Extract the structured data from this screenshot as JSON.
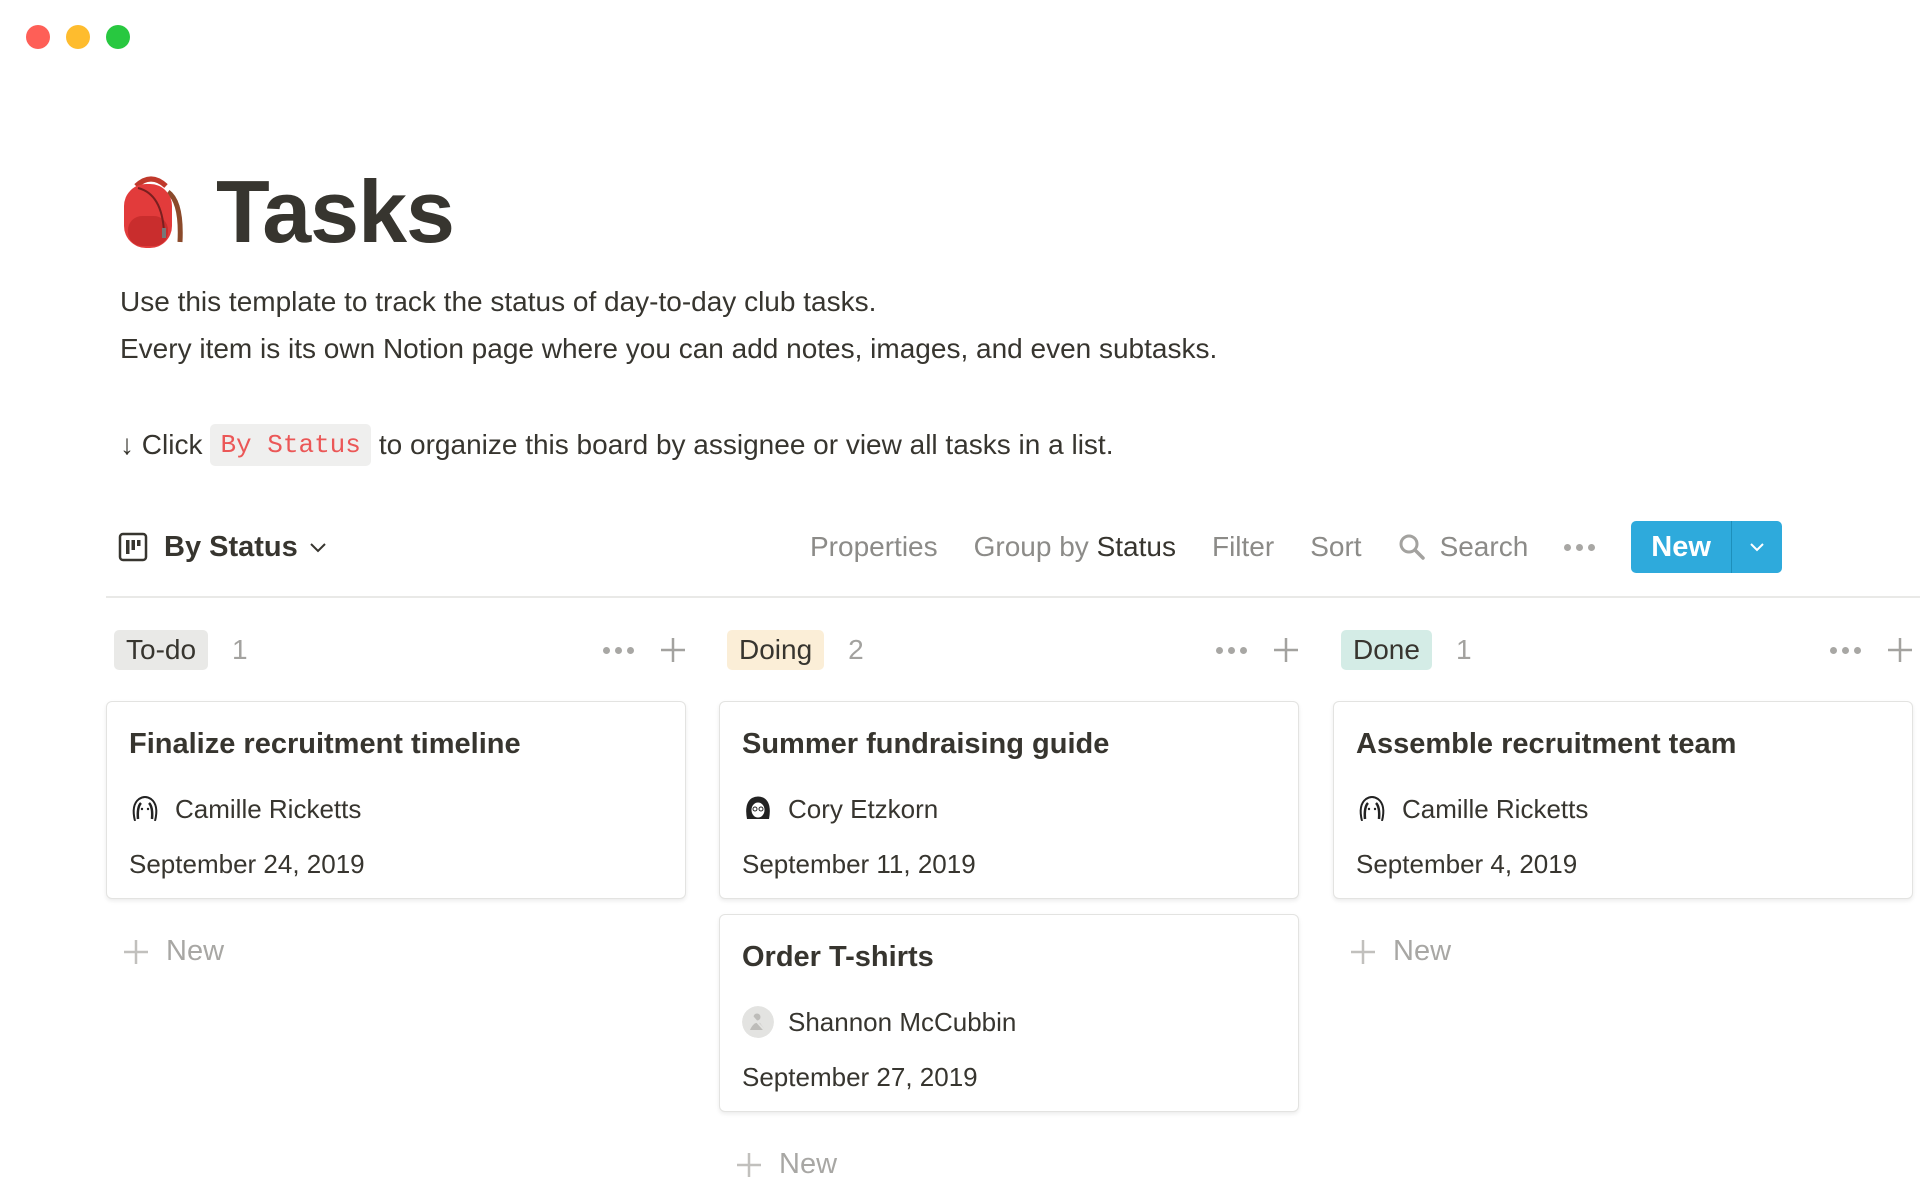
{
  "window": {
    "controls": [
      "close",
      "minimize",
      "zoom"
    ]
  },
  "page": {
    "icon": "backpack-emoji",
    "title": "Tasks",
    "description": [
      "Use this template to track the status of day-to-day club tasks.",
      "Every item is its own Notion page where you can add notes, images, and even subtasks."
    ],
    "hint": {
      "arrow": "↓",
      "before": " Click",
      "code": "By Status",
      "after": "to organize this board by assignee or view all tasks in a list."
    }
  },
  "toolbar": {
    "view_icon": "board-icon",
    "view_label": "By Status",
    "properties": "Properties",
    "group_by_prefix": "Group by ",
    "group_by_value": "Status",
    "filter": "Filter",
    "sort": "Sort",
    "search": "Search",
    "new_label": "New",
    "colors": {
      "new_button": "#2eaadc"
    }
  },
  "board": {
    "add_new_label": "New",
    "columns": [
      {
        "label": "To-do",
        "count": "1",
        "tag_color": "#e9e9e7",
        "cards": [
          {
            "title": "Finalize recruitment timeline",
            "assignee": "Camille Ricketts",
            "date": "September 24, 2019"
          }
        ]
      },
      {
        "label": "Doing",
        "count": "2",
        "tag_color": "#fbeed7",
        "cards": [
          {
            "title": "Summer fundraising guide",
            "assignee": "Cory Etzkorn",
            "date": "September 11, 2019"
          },
          {
            "title": "Order T-shirts",
            "assignee": "Shannon McCubbin",
            "date": "September 27, 2019"
          }
        ]
      },
      {
        "label": "Done",
        "count": "1",
        "tag_color": "#d4ece6",
        "cards": [
          {
            "title": "Assemble recruitment team",
            "assignee": "Camille Ricketts",
            "date": "September 4, 2019"
          }
        ]
      }
    ]
  }
}
